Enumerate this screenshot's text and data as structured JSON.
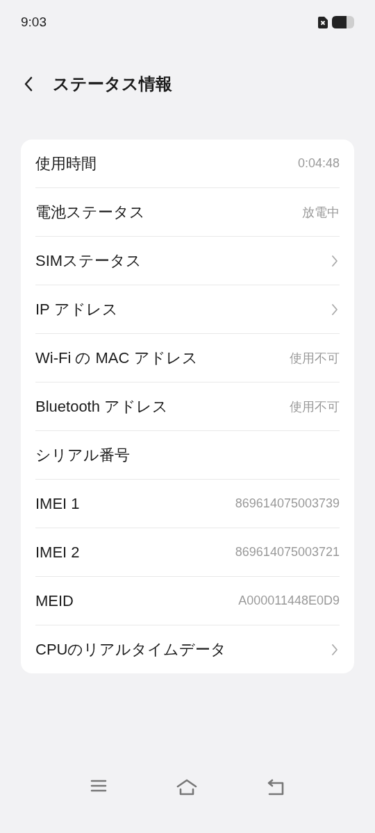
{
  "status_bar": {
    "time": "9:03"
  },
  "header": {
    "title": "ステータス情報"
  },
  "rows": [
    {
      "kind": "value",
      "label": "使用時間",
      "value": "0:04:48"
    },
    {
      "kind": "value",
      "label": "電池ステータス",
      "value": "放電中"
    },
    {
      "kind": "link",
      "label": "SIMステータス"
    },
    {
      "kind": "link",
      "label": "IP アドレス"
    },
    {
      "kind": "value",
      "label": "Wi-Fi の MAC アドレス",
      "value": "使用不可"
    },
    {
      "kind": "value",
      "label": "Bluetooth アドレス",
      "value": "使用不可"
    },
    {
      "kind": "plain",
      "label": "シリアル番号"
    },
    {
      "kind": "value",
      "label": "IMEI 1",
      "value": "869614075003739"
    },
    {
      "kind": "value",
      "label": "IMEI 2",
      "value": "869614075003721"
    },
    {
      "kind": "value",
      "label": "MEID",
      "value": "A000011448E0D9"
    },
    {
      "kind": "link",
      "label": "CPUのリアルタイムデータ"
    }
  ]
}
